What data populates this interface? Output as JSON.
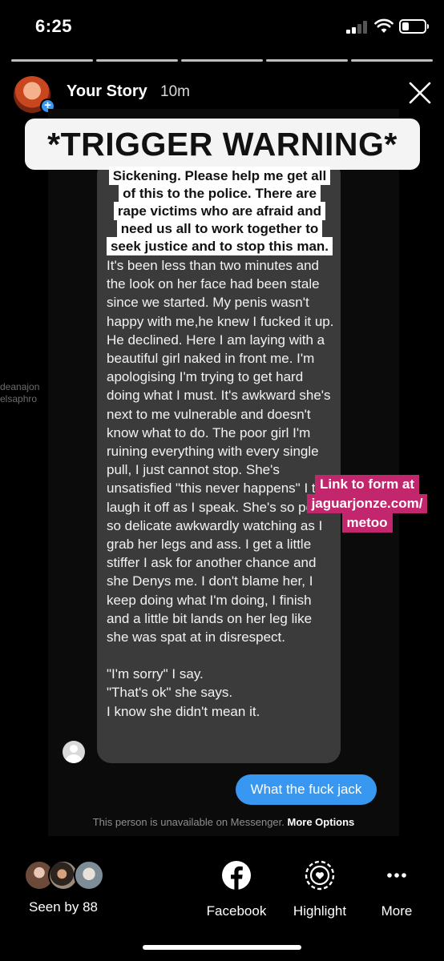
{
  "status_bar": {
    "time": "6:25",
    "signal_bars_filled": 2,
    "battery_level": 0.3
  },
  "story": {
    "progress_segments": 5,
    "title": "Your Story",
    "age": "10m"
  },
  "overlay": {
    "trigger_warning": "*TRIGGER WARNING*",
    "plea_lines": [
      "Sickening. Please help me get all",
      "of this to the police. There are",
      "rape victims who are afraid and",
      "need us all to work together to",
      "seek justice and to stop this man."
    ],
    "link_lines": [
      "Link to form at",
      "jaguarjonze.com/",
      "metoo"
    ]
  },
  "screenshot": {
    "side_names": [
      "deanajon",
      "elsaphro"
    ],
    "message_paragraphs": [
      "It's been less than two minutes and the look on her face had been stale since we started. My penis wasn't happy with me,he knew I fucked it up. He declined. Here I am laying with a beautiful girl naked in front me. I'm apologising I'm trying to get hard doing what I must. It's awkward she's next to me vulnerable and doesn't know what to do. The poor girl I'm ruining everything with every single pull, I just cannot stop. She's unsatisfied \"this never happens\" I try laugh it off as I speak. She's so polite so delicate awkwardly watching as I grab her legs and ass. I get a little stiffer I ask for another chance and she Denys me. I don't blame her, I keep doing what I'm doing, I finish and a little bit lands on her leg like she was spat at in disrespect.",
      "\"I'm sorry\" I say.\n\"That's ok\" she says.\nI know she didn't mean it."
    ],
    "reply": "What the fuck jack",
    "unavailable_text": "This person is unavailable on Messenger.",
    "more_options": "More Options"
  },
  "bottom_bar": {
    "seen_by": "Seen by 88",
    "actions": [
      {
        "label": "Facebook",
        "icon": "facebook-icon"
      },
      {
        "label": "Highlight",
        "icon": "highlight-icon"
      },
      {
        "label": "More",
        "icon": "more-icon"
      }
    ]
  },
  "colors": {
    "background": "#000000",
    "message_bubble": "#3b3b3b",
    "reply_bubble": "#3897f0",
    "link_sticker": "#c2276d",
    "sticker_white": "#f4f4f4"
  }
}
